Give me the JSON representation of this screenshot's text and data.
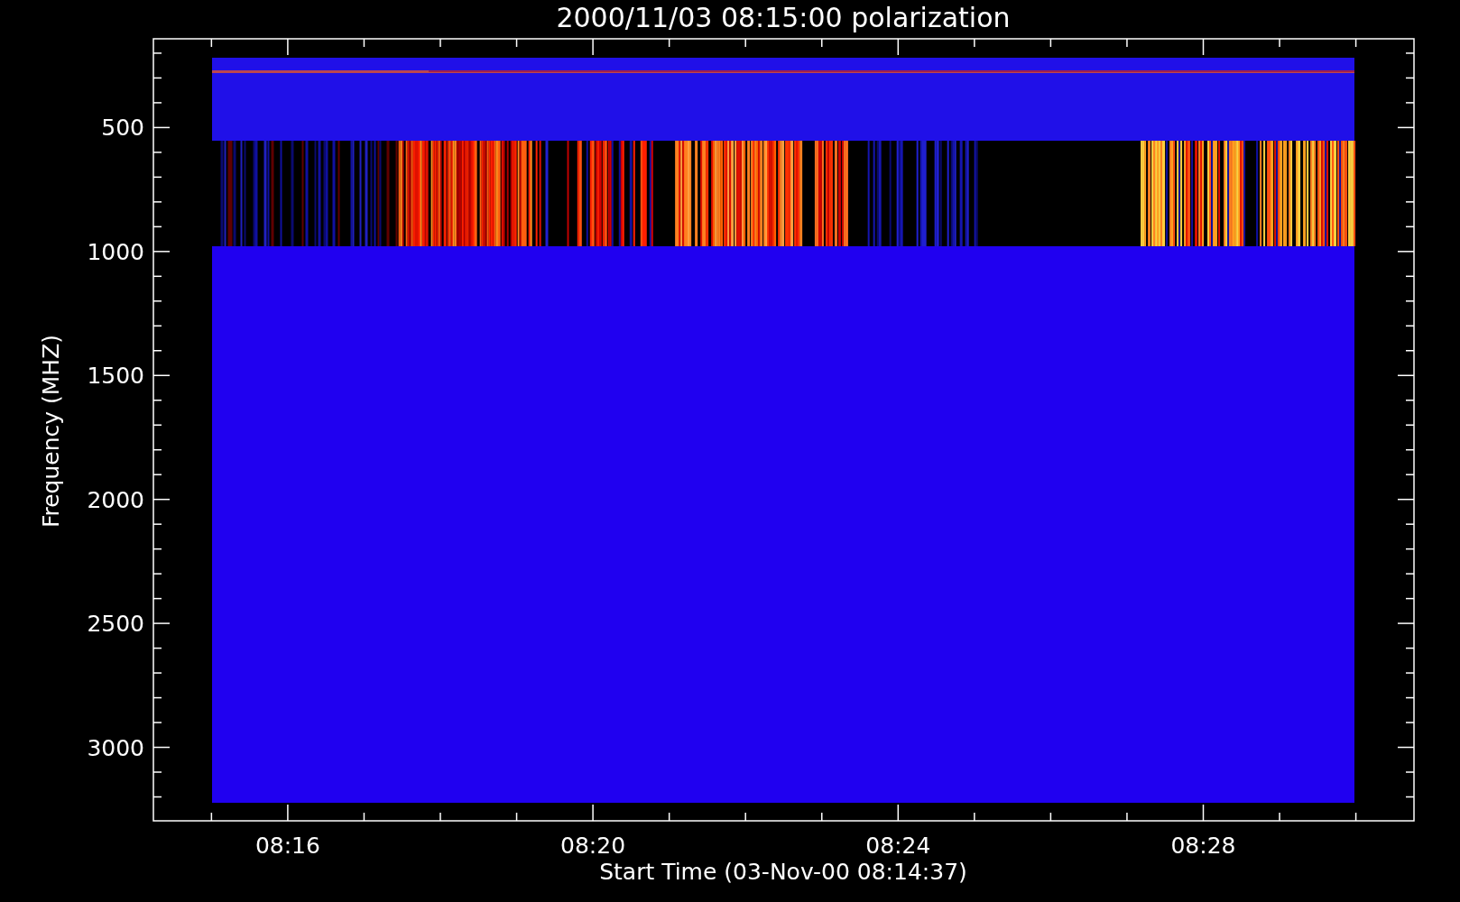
{
  "plot": {
    "title": "2000/11/03 08:15:00 polarization",
    "ylabel": "Frequency (MHZ)",
    "xlabel": "Start Time (03-Nov-00 08:14:37)",
    "yticks": [
      "500",
      "1000",
      "1500",
      "2000",
      "2500",
      "3000"
    ],
    "xticks": [
      "08:16",
      "08:20",
      "08:24",
      "08:28"
    ]
  }
}
